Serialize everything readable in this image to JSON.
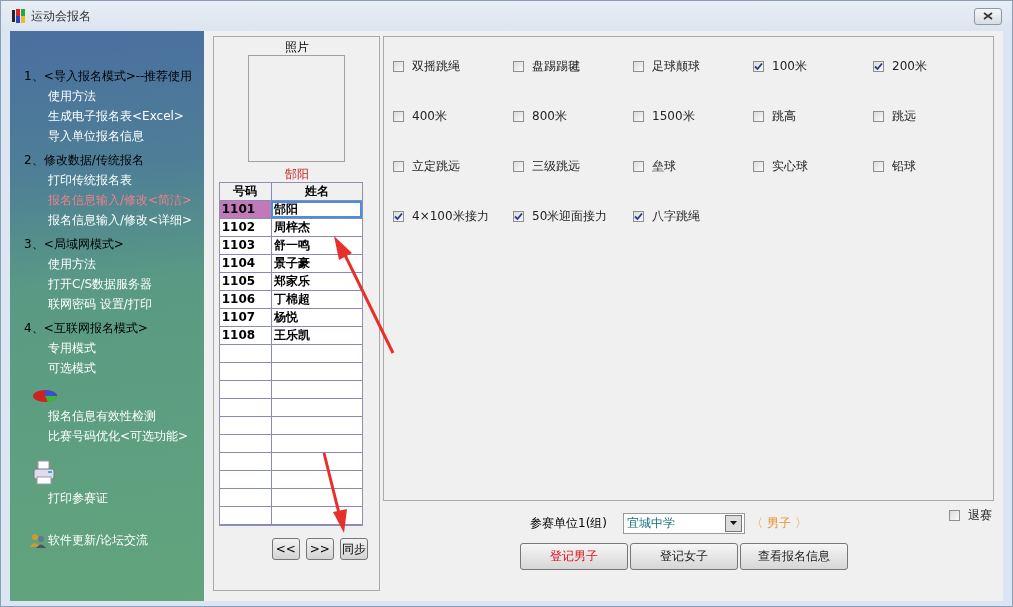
{
  "window": {
    "title": "运动会报名"
  },
  "sidebar": [
    {
      "kind": "numbered",
      "title": "1、<导入报名模式>--推荐使用",
      "items": [
        {
          "label": "使用方法",
          "selected": false
        },
        {
          "label": "生成电子报名表<Excel>",
          "selected": false
        },
        {
          "label": "导入单位报名信息",
          "selected": false
        }
      ]
    },
    {
      "kind": "numbered",
      "title": "2、修改数据/传统报名",
      "items": [
        {
          "label": "打印传统报名表",
          "selected": false
        },
        {
          "label": "报名信息输入/修改<简洁>",
          "selected": true
        },
        {
          "label": "报名信息输入/修改<详细>",
          "selected": false
        }
      ]
    },
    {
      "kind": "numbered",
      "title": "3、<局域网模式>",
      "items": [
        {
          "label": "使用方法",
          "selected": false
        },
        {
          "label": "打开C/S数据服务器",
          "selected": false
        },
        {
          "label": "联网密码 设置/打印",
          "selected": false
        }
      ]
    },
    {
      "kind": "numbered",
      "title": "4、<互联网报名模式>",
      "items": [
        {
          "label": "专用模式",
          "selected": false
        },
        {
          "label": "可选模式",
          "selected": false
        }
      ]
    },
    {
      "kind": "chart",
      "items": [
        {
          "label": "报名信息有效性检测",
          "selected": false
        },
        {
          "label": "比赛号码优化<可选功能>",
          "selected": false
        }
      ]
    },
    {
      "kind": "printer",
      "items": [
        {
          "label": "打印参赛证",
          "selected": false
        }
      ]
    },
    {
      "kind": "update",
      "items": [
        {
          "label": "软件更新/论坛交流",
          "selected": false
        }
      ]
    }
  ],
  "photo": {
    "label": "照片",
    "name": "郜阳"
  },
  "table": {
    "columns": [
      "号码",
      "姓名"
    ],
    "rows": [
      {
        "number": "1101",
        "name": "郜阳",
        "selected": true
      },
      {
        "number": "1102",
        "name": "周梓杰",
        "selected": false
      },
      {
        "number": "1103",
        "name": "舒一鸣",
        "selected": false
      },
      {
        "number": "1104",
        "name": "景子豪",
        "selected": false
      },
      {
        "number": "1105",
        "name": "郑家乐",
        "selected": false
      },
      {
        "number": "1106",
        "name": "丁棉超",
        "selected": false
      },
      {
        "number": "1107",
        "name": "杨悦",
        "selected": false
      },
      {
        "number": "1108",
        "name": "王乐凯",
        "selected": false
      }
    ]
  },
  "nav_buttons": [
    "<<",
    ">>",
    "同步"
  ],
  "events": [
    {
      "label": "双摇跳绳",
      "checked": false
    },
    {
      "label": "盘踢踢毽",
      "checked": false
    },
    {
      "label": "足球颠球",
      "checked": false
    },
    {
      "label": "100米",
      "checked": true
    },
    {
      "label": "200米",
      "checked": true
    },
    {
      "label": "400米",
      "checked": false
    },
    {
      "label": "800米",
      "checked": false
    },
    {
      "label": "1500米",
      "checked": false
    },
    {
      "label": "跳高",
      "checked": false
    },
    {
      "label": "跳远",
      "checked": false
    },
    {
      "label": "立定跳远",
      "checked": false
    },
    {
      "label": "三级跳远",
      "checked": false
    },
    {
      "label": "垒球",
      "checked": false
    },
    {
      "label": "实心球",
      "checked": false
    },
    {
      "label": "铅球",
      "checked": false
    },
    {
      "label": "4×100米接力",
      "checked": true
    },
    {
      "label": "50米迎面接力",
      "checked": true
    },
    {
      "label": "八字跳绳",
      "checked": true
    }
  ],
  "unit": {
    "label": "参赛单位1(组)",
    "value": "宜城中学",
    "gender": "〈 男子 〉"
  },
  "withdraw": {
    "label": "退赛",
    "checked": false
  },
  "actions": [
    {
      "label": "登记男子",
      "selected": true
    },
    {
      "label": "登记女子",
      "selected": false
    },
    {
      "label": "查看报名信息",
      "selected": false
    }
  ]
}
